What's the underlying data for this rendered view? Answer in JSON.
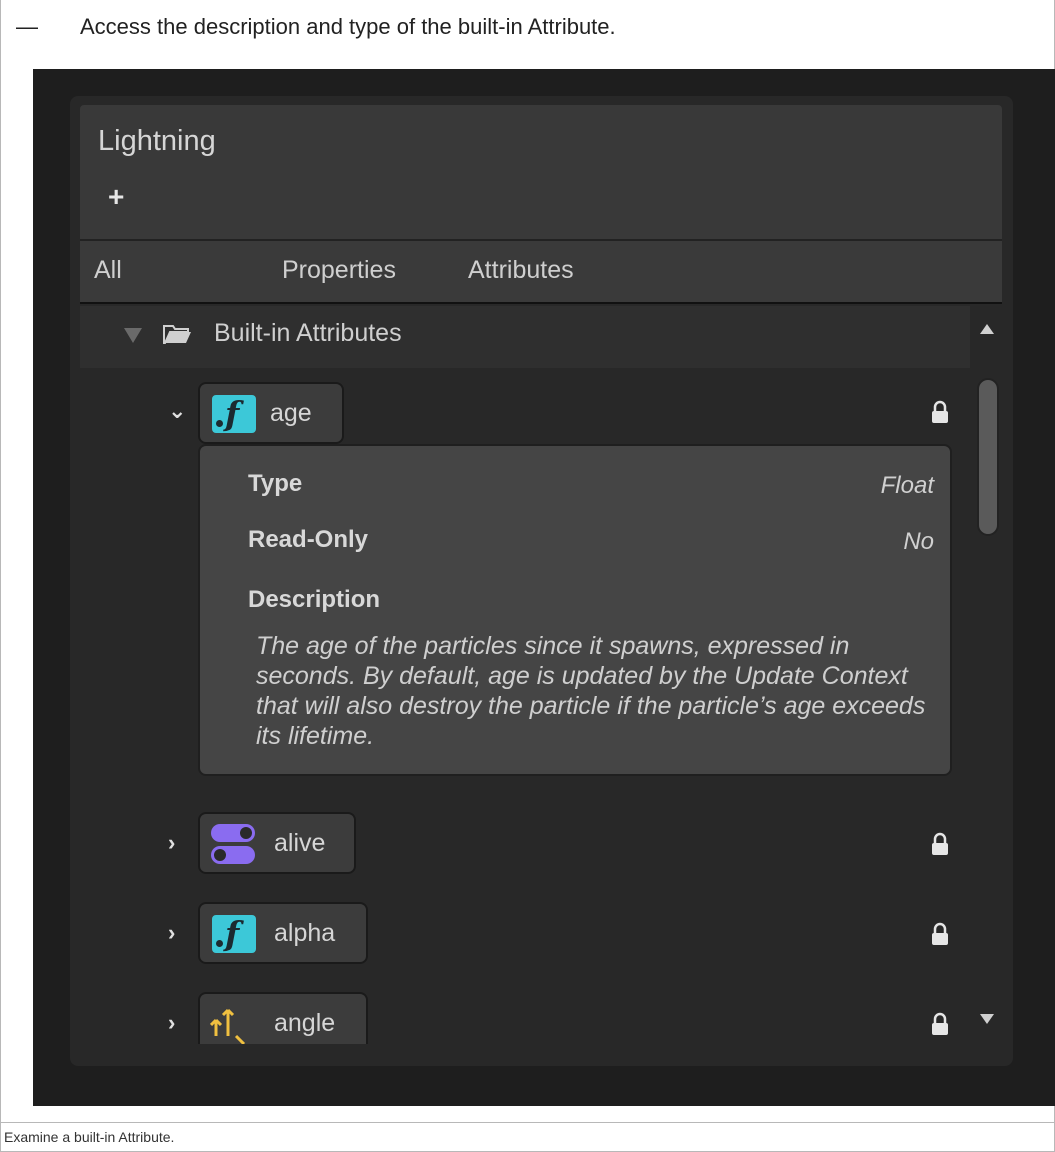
{
  "intro": {
    "bullet": "—",
    "text": "Access the description and type of the built-in Attribute."
  },
  "panel": {
    "title": "Lightning",
    "add_label": "+",
    "tabs": [
      "All",
      "Properties",
      "Attributes"
    ]
  },
  "group": {
    "label": "Built-in Attributes",
    "expanded": true
  },
  "attributes": [
    {
      "name": "age",
      "icon": "float-icon",
      "expanded": true,
      "locked": true
    },
    {
      "name": "alive",
      "icon": "bool-toggle-icon",
      "expanded": false,
      "locked": true
    },
    {
      "name": "alpha",
      "icon": "float-icon",
      "expanded": false,
      "locked": true
    },
    {
      "name": "angle",
      "icon": "vector3-icon",
      "expanded": false,
      "locked": true
    }
  ],
  "detail": {
    "type_label": "Type",
    "type_value": "Float",
    "readonly_label": "Read-Only",
    "readonly_value": "No",
    "description_label": "Description",
    "description": "The age of the particles since it spawns, expressed in seconds. By default, age is updated by the Update Context that will also destroy the particle if the particle’s age exceeds its lifetime."
  },
  "caption": "Examine a built-in Attribute.",
  "colors": {
    "background": "#1e1e1e",
    "panel": "#282828",
    "float_icon": "#3cc8d8",
    "bool_icon": "#8a6cf0",
    "vector_icon": "#f0c040"
  }
}
